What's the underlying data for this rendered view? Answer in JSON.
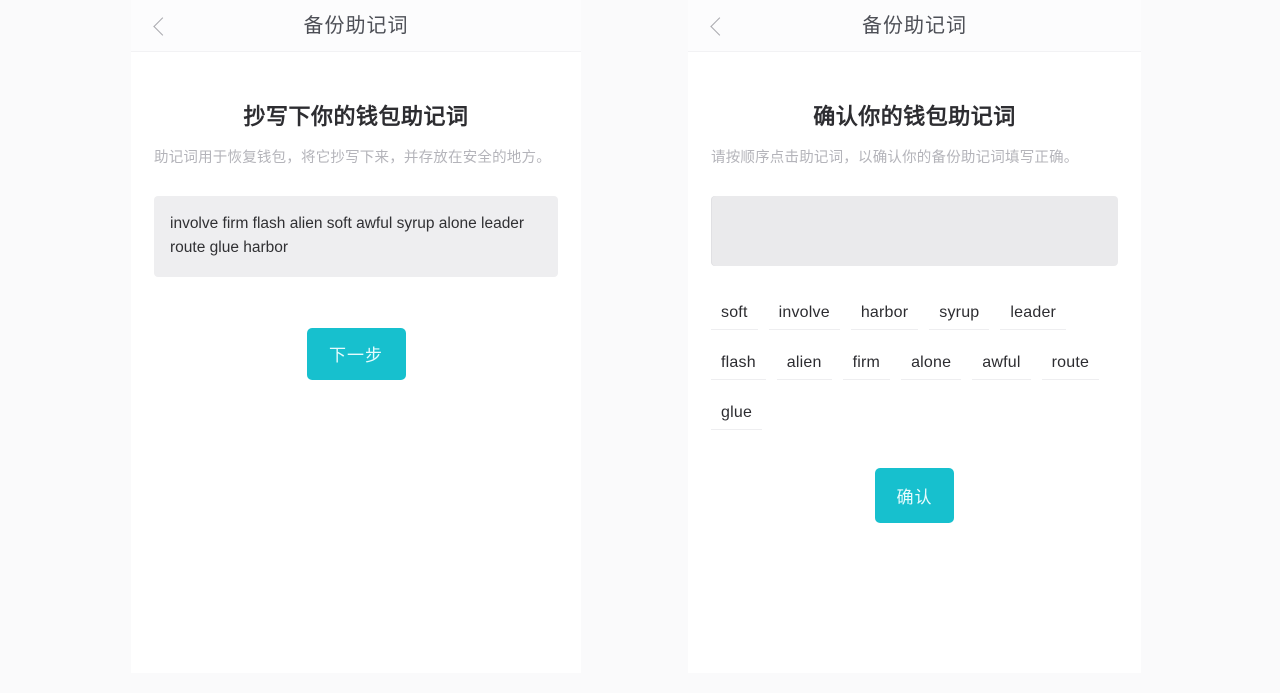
{
  "screen": {
    "background_color": "#fafafb",
    "panel_background": "#ffffff",
    "accent_color": "#17c0ce",
    "box_color": "#eeeef0"
  },
  "left_panel": {
    "nav": {
      "back_icon": "chevron-left-icon",
      "title": "备份助记词"
    },
    "title": "抄写下你的钱包助记词",
    "subtitle": "助记词用于恢复钱包，将它抄写下来，并存放在安全的地方。",
    "mnemonic_phrase": "involve firm flash alien soft awful syrup alone leader route glue harbor",
    "mnemonic_words": [
      "involve",
      "firm",
      "flash",
      "alien",
      "soft",
      "awful",
      "syrup",
      "alone",
      "leader",
      "route",
      "glue",
      "harbor"
    ],
    "next_button_label": "下一步"
  },
  "right_panel": {
    "nav": {
      "back_icon": "chevron-left-icon",
      "title": "备份助记词"
    },
    "title": "确认你的钱包助记词",
    "subtitle": "请按顺序点击助记词，以确认你的备份助记词填写正确。",
    "answer_box_value": "",
    "word_choices": [
      "soft",
      "involve",
      "harbor",
      "syrup",
      "leader",
      "flash",
      "alien",
      "firm",
      "alone",
      "awful",
      "route",
      "glue"
    ],
    "confirm_button_label": "确认"
  }
}
